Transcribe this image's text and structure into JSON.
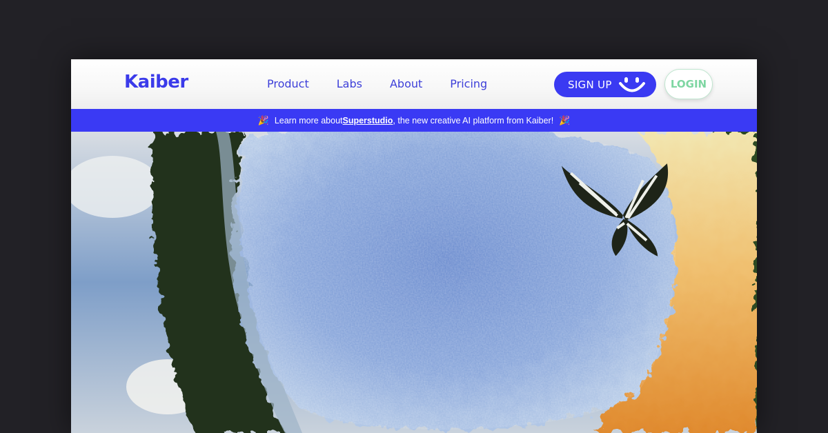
{
  "brand": {
    "logo_text": "Kaiber",
    "accent": "#3a3af2",
    "login_color": "#7ed6a2"
  },
  "nav": {
    "links": [
      {
        "label": "Product"
      },
      {
        "label": "Labs"
      },
      {
        "label": "About"
      },
      {
        "label": "Pricing"
      }
    ]
  },
  "actions": {
    "signup_label": "SIGN UP",
    "signup_icon": "smile-icon",
    "login_label": "LOGIN"
  },
  "banner": {
    "prefix": "Learn more about ",
    "link_text": "Superstudio",
    "suffix": ", the new creative AI platform from Kaiber!",
    "emoji": "🎉"
  },
  "hero": {
    "image": "artwork: blue brushstroke portal, tree silhouette, clouds, orange paint wash, black-and-white butterfly"
  }
}
